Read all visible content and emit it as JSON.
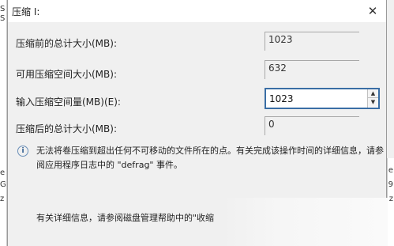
{
  "background_window": {
    "left_fragments": [
      "S",
      "S",
      "e",
      "G",
      "z"
    ],
    "right_fragments": [
      "e",
      "9",
      "z"
    ]
  },
  "dialog": {
    "title": "压缩 I:",
    "close_glyph": "✕",
    "rows": [
      {
        "label": "压缩前的总计大小(MB):",
        "value": "1023"
      },
      {
        "label": "可用压缩空间大小(MB):",
        "value": "632"
      },
      {
        "label": "输入压缩空间量(MB)(E):",
        "value": "1023"
      },
      {
        "label": "压缩后的总计大小(MB):",
        "value": "0"
      }
    ],
    "info_icon": "i",
    "info_text": "无法将卷压缩到超出任何不可移动的文件所在的点。有关完成该操作时间的详细信息，请参阅应用程序日志中的 \"defrag\" 事件。",
    "help_text": "有关详细信息，请参阅磁盘管理帮助中的\"收缩"
  }
}
